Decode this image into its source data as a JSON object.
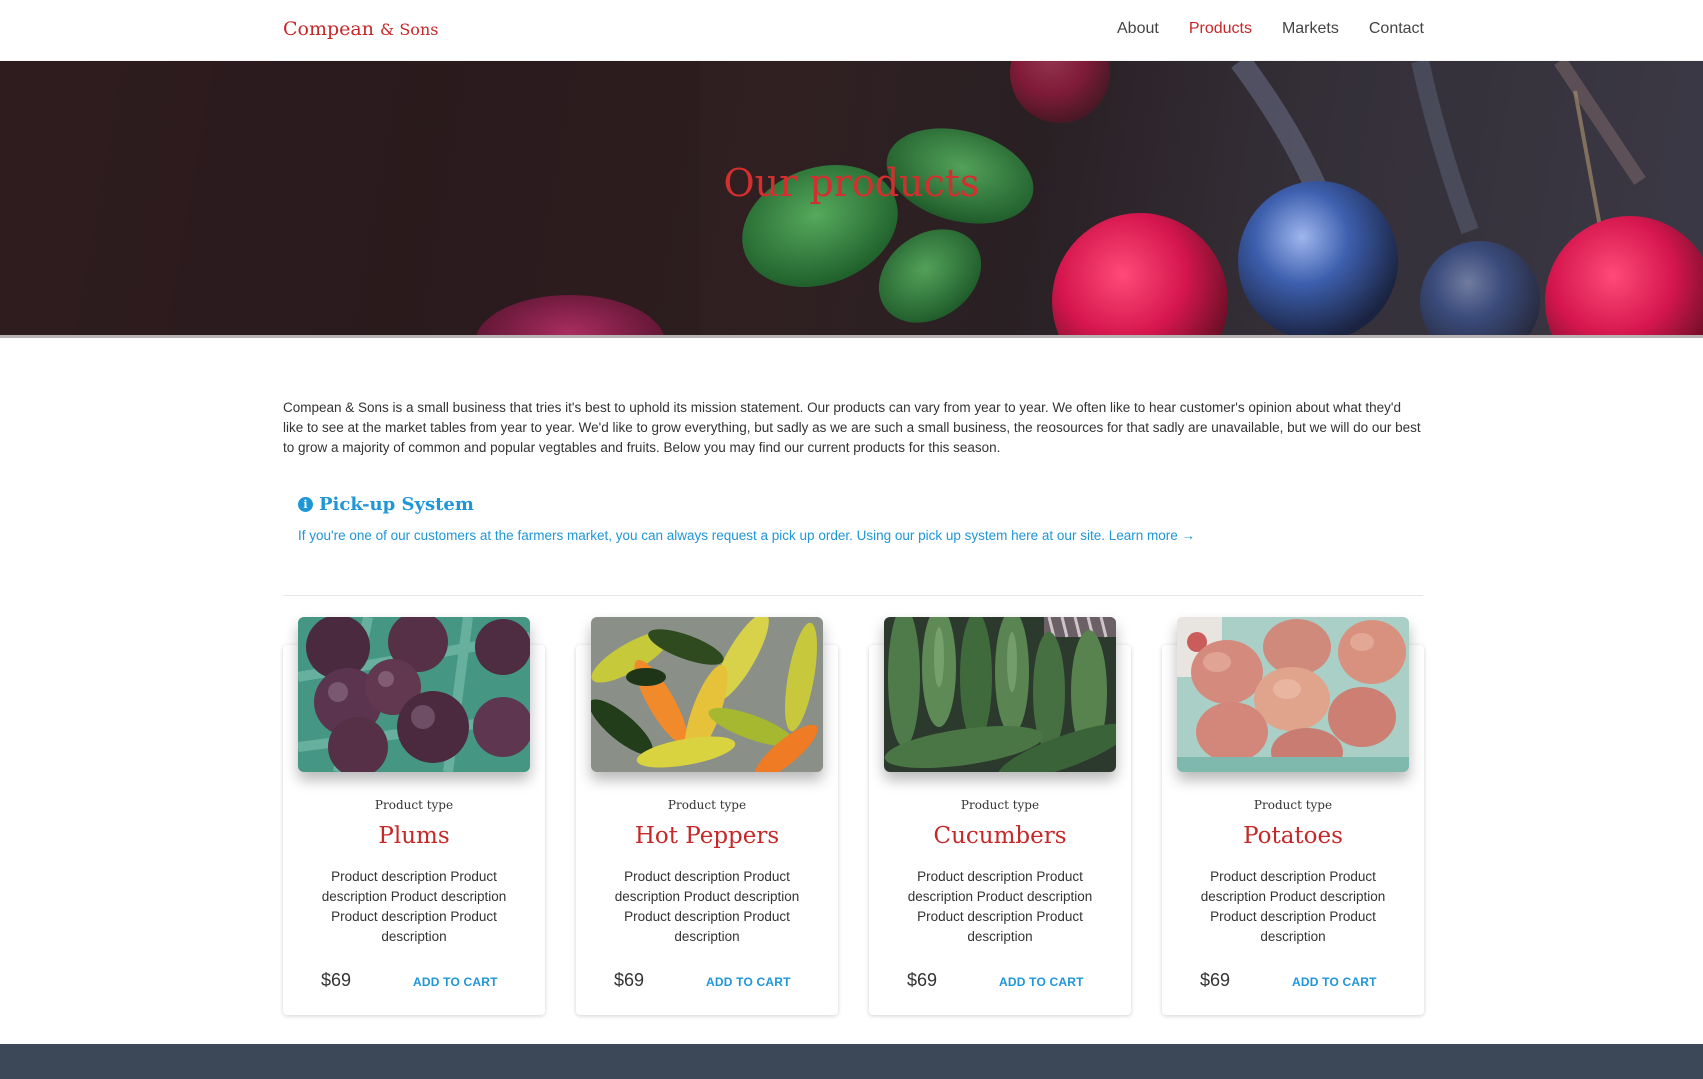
{
  "brand": {
    "name": "Compean",
    "suffix": "& Sons",
    "color": "#c62828"
  },
  "nav": {
    "items": [
      {
        "label": "About",
        "active": false
      },
      {
        "label": "Products",
        "active": true
      },
      {
        "label": "Markets",
        "active": false
      },
      {
        "label": "Contact",
        "active": false
      }
    ]
  },
  "hero": {
    "title": "Our products"
  },
  "intro": {
    "text": "Compean & Sons is a small business that tries it's best to uphold its mission statement. Our products can vary from year to year. We often like to hear customer's opinion about what they'd like to see at the market tables from year to year. We'd like to grow everything, but sadly as we are such a small business, the reosources for that sadly are unavailable, but we will do our best to grow a majority of common and popular vegtables and fruits. Below you may find our current products for this season."
  },
  "pickup": {
    "icon": "info-circle-icon",
    "heading": "Pick-up System",
    "text": "If you're one of our customers at the farmers market, you can always request a pick up order. Using our pick up system here at our site.",
    "link": "Learn more →",
    "color": "#1e96d8"
  },
  "products": [
    {
      "type": "Product type",
      "name": "Plums",
      "description": "Product description Product description Product description Product description Product description",
      "price": "$69",
      "cart_label": "ADD TO CART"
    },
    {
      "type": "Product type",
      "name": "Hot Peppers",
      "description": "Product description Product description Product description Product description Product description",
      "price": "$69",
      "cart_label": "ADD TO CART"
    },
    {
      "type": "Product type",
      "name": "Cucumbers",
      "description": "Product description Product description Product description Product description Product description",
      "price": "$69",
      "cart_label": "ADD TO CART"
    },
    {
      "type": "Product type",
      "name": "Potatoes",
      "description": "Product description Product description Product description Product description Product description",
      "price": "$69",
      "cart_label": "ADD TO CART"
    }
  ],
  "colors": {
    "accent_red": "#c62828",
    "link_blue": "#1e96d8",
    "footer": "#3c4858"
  }
}
